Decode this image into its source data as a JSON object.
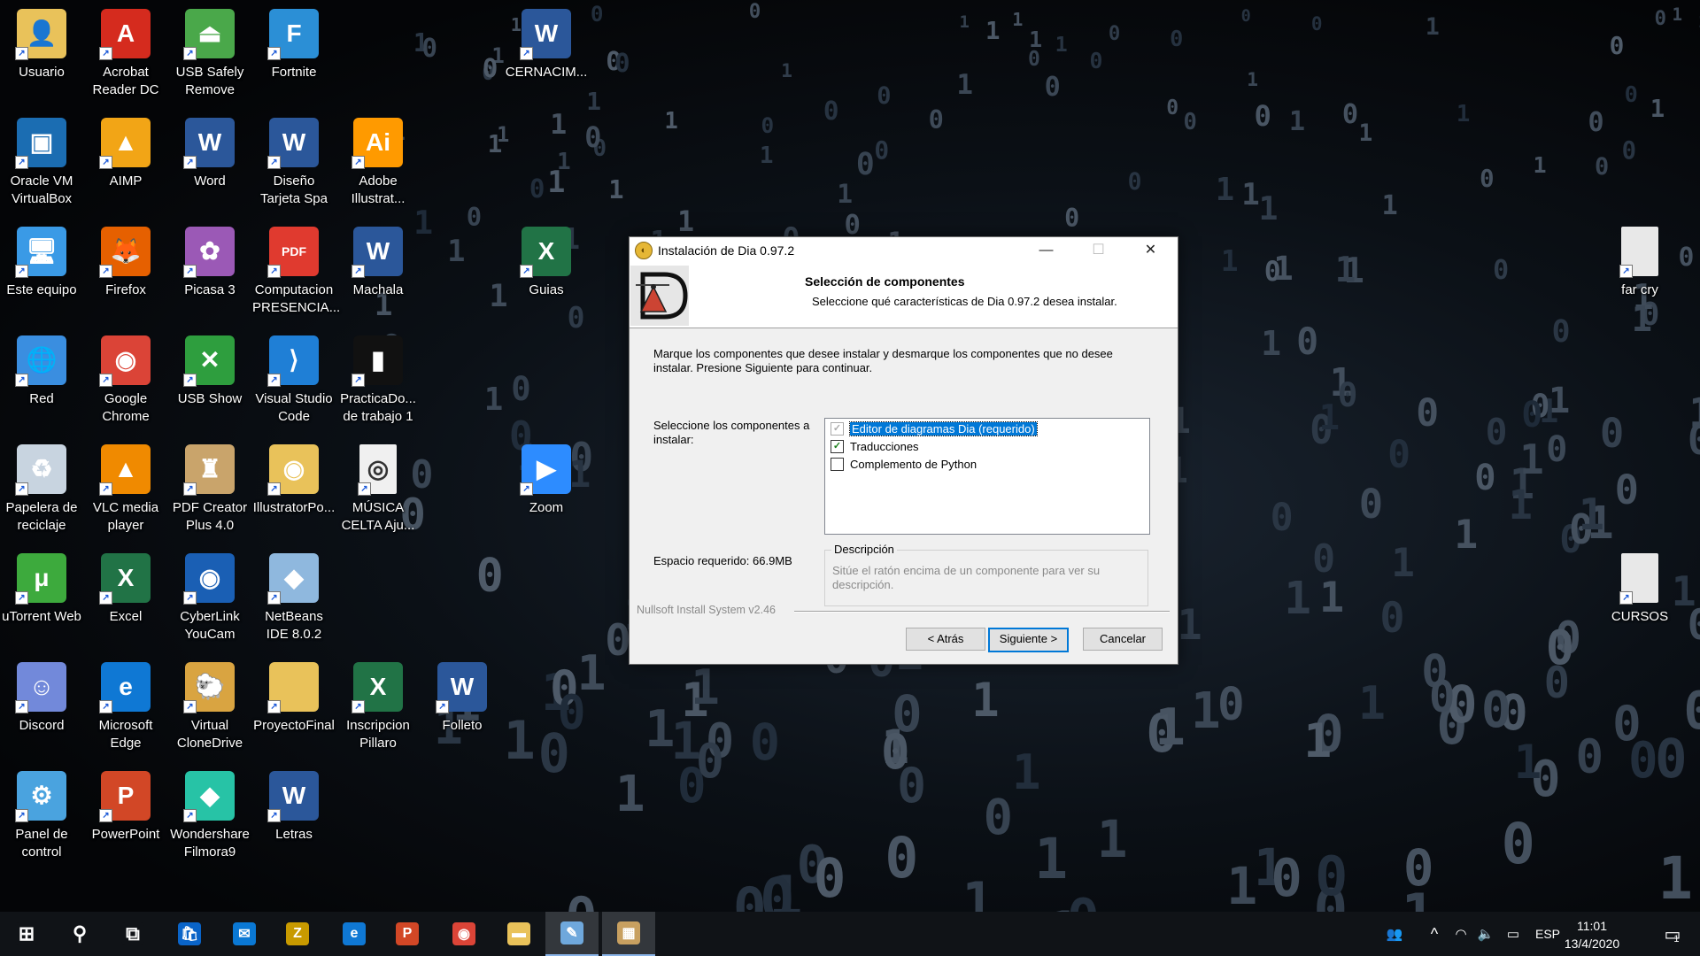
{
  "desktop": {
    "icons": [
      {
        "label": "Usuario",
        "icon": "user-folder-icon",
        "color": "#e9c25a",
        "glyph": "👤"
      },
      {
        "label": "Acrobat Reader DC",
        "icon": "acrobat-reader-icon",
        "color": "#d52b1e",
        "glyph": "A"
      },
      {
        "label": "USB Safely Remove",
        "icon": "usb-safely-remove-icon",
        "color": "#4aa84a",
        "glyph": "⏏"
      },
      {
        "label": "Fortnite",
        "icon": "fortnite-icon",
        "color": "#2b8fd6",
        "glyph": "F"
      },
      {
        "label": "CERNACIM...",
        "icon": "word-document-icon",
        "color": "#2b579a",
        "glyph": "W"
      },
      {
        "label": "Oracle VM VirtualBox",
        "icon": "virtualbox-icon",
        "color": "#1b6db2",
        "glyph": "▣"
      },
      {
        "label": "AIMP",
        "icon": "aimp-icon",
        "color": "#f2a516",
        "glyph": "▲"
      },
      {
        "label": "Word",
        "icon": "word-icon",
        "color": "#2b579a",
        "glyph": "W"
      },
      {
        "label": "Diseño Tarjeta Spa",
        "icon": "word-document-icon",
        "color": "#2b579a",
        "glyph": "W"
      },
      {
        "label": "Adobe Illustrat...",
        "icon": "illustrator-icon",
        "color": "#ff9a00",
        "glyph": "Ai"
      },
      {
        "label": "Este equipo",
        "icon": "this-pc-icon",
        "color": "#3a9ae6",
        "glyph": "🖥"
      },
      {
        "label": "Firefox",
        "icon": "firefox-icon",
        "color": "#e66000",
        "glyph": "🦊"
      },
      {
        "label": "Picasa 3",
        "icon": "picasa-icon",
        "color": "#9b59b6",
        "glyph": "✿"
      },
      {
        "label": "Computacion PRESENCIA...",
        "icon": "pdf-document-icon",
        "color": "#e03a2f",
        "glyph": "PDF"
      },
      {
        "label": "Machala",
        "icon": "word-document-icon",
        "color": "#2b579a",
        "glyph": "W"
      },
      {
        "label": "Guias",
        "icon": "excel-document-icon",
        "color": "#217346",
        "glyph": "X"
      },
      {
        "label": "far cry",
        "icon": "blank-file-icon",
        "color": "#e8e8e8",
        "glyph": ""
      },
      {
        "label": "Red",
        "icon": "network-icon",
        "color": "#3a8ee0",
        "glyph": "🌐"
      },
      {
        "label": "Google Chrome",
        "icon": "chrome-icon",
        "color": "#db4437",
        "glyph": "◉"
      },
      {
        "label": "USB Show",
        "icon": "usb-show-icon",
        "color": "#2e9e3e",
        "glyph": "✕"
      },
      {
        "label": "Visual Studio Code",
        "icon": "vscode-icon",
        "color": "#1f7fd6",
        "glyph": "⟩"
      },
      {
        "label": "PracticaDo... de trabajo 1",
        "icon": "terminal-file-icon",
        "color": "#111",
        "glyph": "▮"
      },
      {
        "label": "Papelera de reciclaje",
        "icon": "recycle-bin-icon",
        "color": "#c8d4e0",
        "glyph": "♻"
      },
      {
        "label": "VLC media player",
        "icon": "vlc-icon",
        "color": "#f08a00",
        "glyph": "▲"
      },
      {
        "label": "PDF Creator Plus 4.0",
        "icon": "pdf-creator-icon",
        "color": "#c9a46b",
        "glyph": "♜"
      },
      {
        "label": "IllustratorPo...",
        "icon": "folder-icon",
        "color": "#e9c25a",
        "glyph": "◉"
      },
      {
        "label": "MÚSICA CELTA Aju...",
        "icon": "music-file-icon",
        "color": "#f0f0f0",
        "glyph": "◎"
      },
      {
        "label": "Zoom",
        "icon": "zoom-icon",
        "color": "#2d8cff",
        "glyph": "▶"
      },
      {
        "label": "uTorrent Web",
        "icon": "utorrent-icon",
        "color": "#3daa3d",
        "glyph": "μ"
      },
      {
        "label": "Excel",
        "icon": "excel-icon",
        "color": "#217346",
        "glyph": "X"
      },
      {
        "label": "CyberLink YouCam",
        "icon": "youcam-icon",
        "color": "#1a5fb4",
        "glyph": "◉"
      },
      {
        "label": "NetBeans IDE 8.0.2",
        "icon": "netbeans-icon",
        "color": "#8fb8de",
        "glyph": "◆"
      },
      {
        "label": "CURSOS",
        "icon": "blank-file-icon",
        "color": "#e8e8e8",
        "glyph": ""
      },
      {
        "label": "Discord",
        "icon": "discord-icon",
        "color": "#7289da",
        "glyph": "☺"
      },
      {
        "label": "Microsoft Edge",
        "icon": "edge-icon",
        "color": "#0f78d4",
        "glyph": "e"
      },
      {
        "label": "Virtual CloneDrive",
        "icon": "clonedrive-icon",
        "color": "#d9a441",
        "glyph": "🐑"
      },
      {
        "label": "ProyectoFinal",
        "icon": "folder-icon",
        "color": "#e9c25a",
        "glyph": ""
      },
      {
        "label": "Inscripcion Pillaro",
        "icon": "excel-document-icon",
        "color": "#217346",
        "glyph": "X"
      },
      {
        "label": "Folleto",
        "icon": "word-document-icon",
        "color": "#2b579a",
        "glyph": "W"
      },
      {
        "label": "Panel de control",
        "icon": "control-panel-icon",
        "color": "#4aa3df",
        "glyph": "⚙"
      },
      {
        "label": "PowerPoint",
        "icon": "powerpoint-icon",
        "color": "#d24726",
        "glyph": "P"
      },
      {
        "label": "Wondershare Filmora9",
        "icon": "filmora-icon",
        "color": "#27c3a6",
        "glyph": "◆"
      },
      {
        "label": "Letras",
        "icon": "word-document-icon",
        "color": "#2b579a",
        "glyph": "W"
      }
    ]
  },
  "dialog": {
    "title": "Instalación de Dia 0.97.2",
    "header_title": "Selección de componentes",
    "header_subtitle": "Seleccione qué características de Dia 0.97.2 desea instalar.",
    "instructions": "Marque los componentes que desee instalar y desmarque los componentes que no desee instalar. Presione Siguiente para continuar.",
    "select_label": "Seleccione los componentes a instalar:",
    "components": [
      {
        "label": "Editor de diagramas Dia (requerido)",
        "checked": true,
        "disabled": true,
        "selected": true
      },
      {
        "label": "Traducciones",
        "checked": true,
        "disabled": false,
        "selected": false
      },
      {
        "label": "Complemento de Python",
        "checked": false,
        "disabled": false,
        "selected": false
      }
    ],
    "space_required": "Espacio requerido: 66.9MB",
    "description_legend": "Descripción",
    "description_text": "Sitúe el ratón encima de un componente para ver su descripción.",
    "branding": "Nullsoft Install System v2.46",
    "buttons": {
      "back": "< Atrás",
      "next": "Siguiente >",
      "cancel": "Cancelar"
    },
    "window_controls": {
      "minimize": "—",
      "maximize": "☐",
      "close": "✕"
    }
  },
  "taskbar": {
    "apps": [
      {
        "name": "start-button",
        "icon": "windows-logo-icon",
        "glyph": "⊞",
        "color": "#101317"
      },
      {
        "name": "search-button",
        "icon": "search-icon",
        "glyph": "⚲",
        "color": "#101317"
      },
      {
        "name": "task-view-button",
        "icon": "task-view-icon",
        "glyph": "⧉",
        "color": "#101317"
      },
      {
        "name": "store-button",
        "icon": "store-icon",
        "glyph": "🛍",
        "color": "#0a64c8"
      },
      {
        "name": "mail-button",
        "icon": "mail-icon",
        "glyph": "✉",
        "color": "#0a78d4"
      },
      {
        "name": "filezilla-button",
        "icon": "z-app-icon",
        "glyph": "Z",
        "color": "#c89a00"
      },
      {
        "name": "edge-button",
        "icon": "edge-icon",
        "glyph": "e",
        "color": "#0f78d4"
      },
      {
        "name": "powerpoint-button",
        "icon": "powerpoint-icon",
        "glyph": "P",
        "color": "#d24726"
      },
      {
        "name": "chrome-button",
        "icon": "chrome-icon",
        "glyph": "◉",
        "color": "#db4437"
      },
      {
        "name": "file-explorer-button",
        "icon": "folder-icon",
        "glyph": "▬",
        "color": "#e9c25a"
      },
      {
        "name": "paint-button",
        "icon": "paint-icon",
        "glyph": "✎",
        "color": "#6fa8dc"
      },
      {
        "name": "installer-button",
        "icon": "installer-icon",
        "glyph": "▦",
        "color": "#c8a060"
      }
    ],
    "tray": {
      "people_icon": "👥",
      "chevron_icon": "^",
      "network_icon": "◠",
      "volume_icon": "🔈",
      "battery_icon": "▭",
      "language": "ESP",
      "time": "11:01",
      "date": "13/4/2020",
      "notification_count": "1"
    }
  }
}
